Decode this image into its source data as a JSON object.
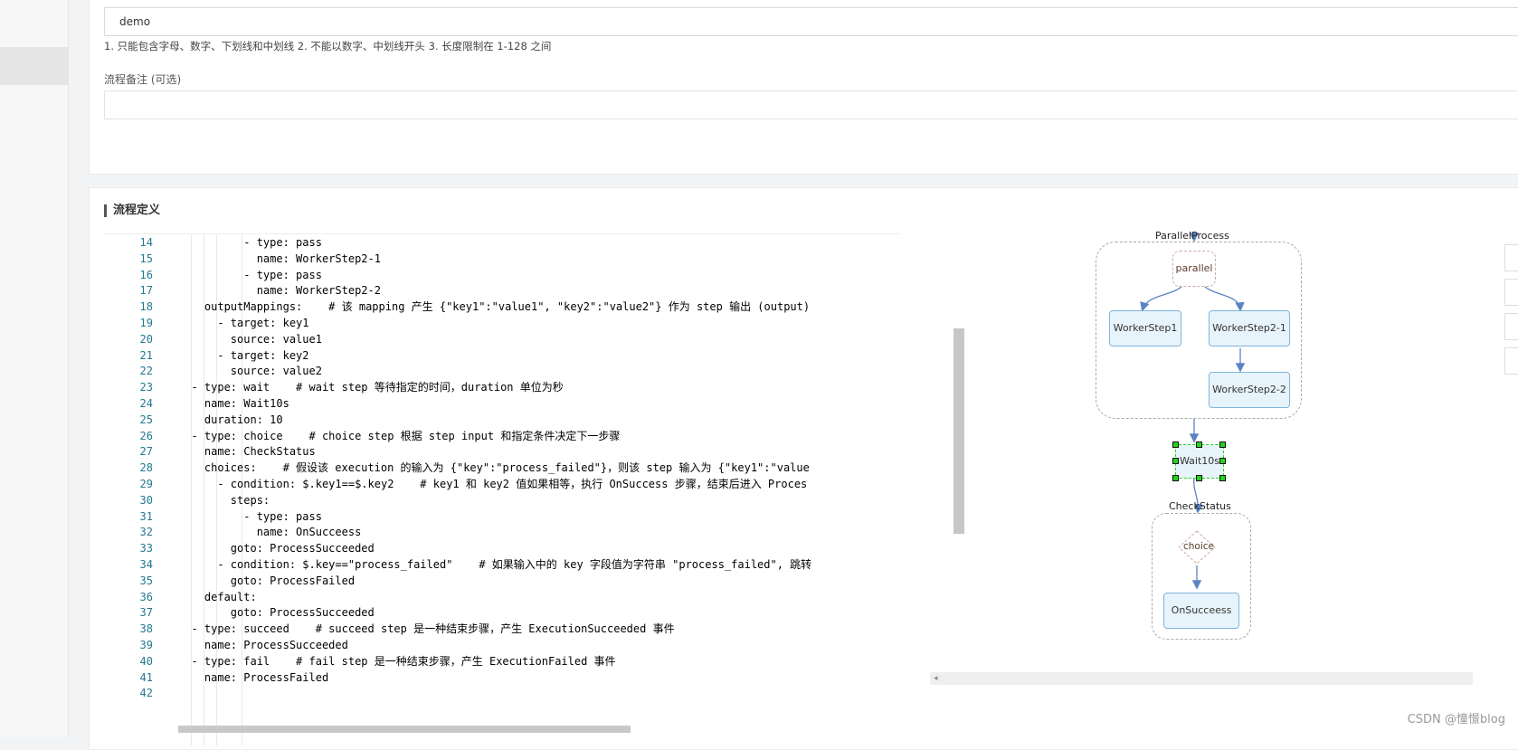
{
  "form": {
    "name_value": "demo",
    "name_hint": "1. 只能包含字母、数字、下划线和中划线 2. 不能以数字、中划线开头 3. 长度限制在 1-128 之间",
    "remark_label": "流程备注 (可选)",
    "remark_value": ""
  },
  "flow_section": {
    "title": "流程定义"
  },
  "editor": {
    "lines": [
      {
        "no": "14",
        "text": "          - type: pass"
      },
      {
        "no": "15",
        "text": "            name: WorkerStep2-1"
      },
      {
        "no": "16",
        "text": "          - type: pass"
      },
      {
        "no": "17",
        "text": "            name: WorkerStep2-2"
      },
      {
        "no": "18",
        "text": "    outputMappings:    # 该 mapping 产生 {\"key1\":\"value1\", \"key2\":\"value2\"} 作为 step 输出 (output)"
      },
      {
        "no": "19",
        "text": "      - target: key1"
      },
      {
        "no": "20",
        "text": "        source: value1"
      },
      {
        "no": "21",
        "text": "      - target: key2"
      },
      {
        "no": "22",
        "text": "        source: value2"
      },
      {
        "no": "23",
        "text": "  - type: wait    # wait step 等待指定的时间，duration 单位为秒"
      },
      {
        "no": "24",
        "text": "    name: Wait10s"
      },
      {
        "no": "25",
        "text": "    duration: 10"
      },
      {
        "no": "26",
        "text": "  - type: choice    # choice step 根据 step input 和指定条件决定下一步骤"
      },
      {
        "no": "27",
        "text": "    name: CheckStatus"
      },
      {
        "no": "28",
        "text": "    choices:    # 假设该 execution 的输入为 {\"key\":\"process_failed\"}，则该 step 输入为 {\"key1\":\"value"
      },
      {
        "no": "29",
        "text": "      - condition: $.key1==$.key2    # key1 和 key2 值如果相等，执行 OnSuccess 步骤，结束后进入 Proces"
      },
      {
        "no": "30",
        "text": "        steps:"
      },
      {
        "no": "31",
        "text": "          - type: pass"
      },
      {
        "no": "32",
        "text": "            name: OnSucceess"
      },
      {
        "no": "33",
        "text": "        goto: ProcessSucceeded"
      },
      {
        "no": "34",
        "text": "      - condition: $.key==\"process_failed\"    # 如果输入中的 key 字段值为字符串 \"process_failed\", 跳转"
      },
      {
        "no": "35",
        "text": "        goto: ProcessFailed"
      },
      {
        "no": "36",
        "text": "    default:"
      },
      {
        "no": "37",
        "text": "        goto: ProcessSucceeded"
      },
      {
        "no": "38",
        "text": "  - type: succeed    # succeed step 是一种结束步骤，产生 ExecutionSucceeded 事件"
      },
      {
        "no": "39",
        "text": "    name: ProcessSucceeded"
      },
      {
        "no": "40",
        "text": "  - type: fail    # fail step 是一种结束步骤，产生 ExecutionFailed 事件"
      },
      {
        "no": "41",
        "text": "    name: ProcessFailed"
      },
      {
        "no": "42",
        "text": ""
      }
    ]
  },
  "graph": {
    "parallel_group_label": "ParallelProcess",
    "parallel_node": "parallel",
    "worker1": "WorkerStep1",
    "worker2_1": "WorkerStep2-1",
    "worker2_2": "WorkerStep2-2",
    "wait_node": "Wait10s",
    "choice_group_label": "CheckStatus",
    "choice_node": "choice",
    "success_node": "OnSucceess",
    "scroll_arrow": "◂"
  },
  "watermark": "CSDN @憧憬blog",
  "colors": {
    "node_fill": "#e8f4fb",
    "node_border": "#7fb5db",
    "edge": "#5b84c4",
    "selection_handle": "#21d51a",
    "line_number": "#237893"
  }
}
